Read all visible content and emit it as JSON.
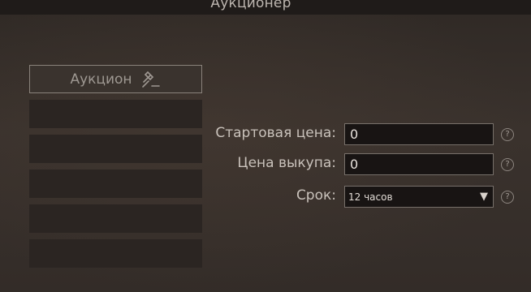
{
  "window": {
    "title": "Аукционер"
  },
  "tabs": {
    "active_label": "Аукцион",
    "active_icon": "gavel-icon",
    "empty_count": 5
  },
  "form": {
    "start_price": {
      "label": "Стартовая цена:",
      "value": "0",
      "help": "?"
    },
    "buyout_price": {
      "label": "Цена выкупа:",
      "value": "0",
      "help": "?"
    },
    "duration": {
      "label": "Срок:",
      "selected": "12 часов",
      "arrow": "▼",
      "help": "?"
    }
  },
  "colors": {
    "background": "#38302b",
    "field_bg": "#181413",
    "field_border": "#77706a",
    "text": "#c9c2bb"
  }
}
